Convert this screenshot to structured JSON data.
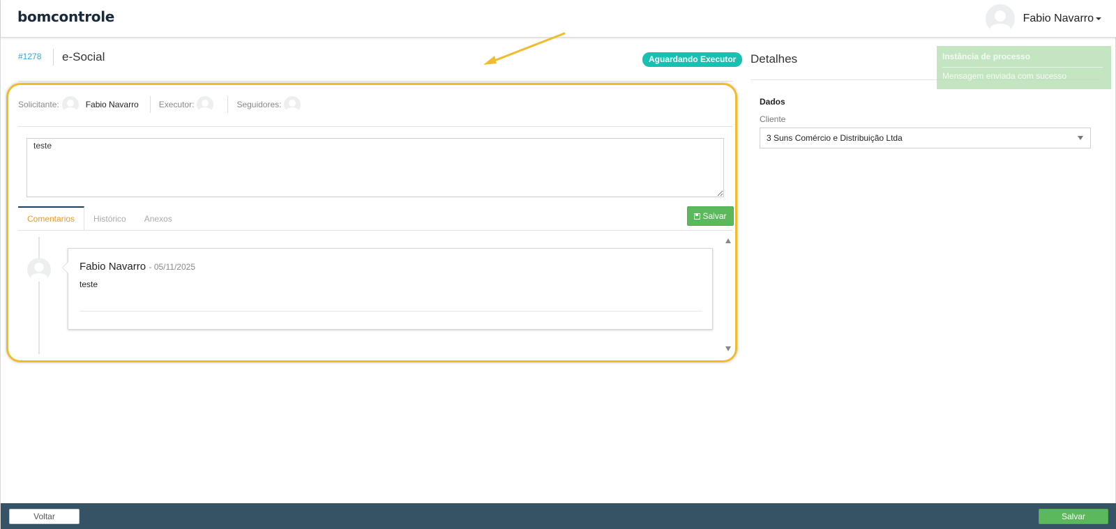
{
  "app": {
    "logo": "bomcontrole"
  },
  "header": {
    "user_name": "Fabio Navarro"
  },
  "task": {
    "id": "#1278",
    "title": "e-Social",
    "status": "Aguardando Executor",
    "status_color": "#17c0b0"
  },
  "people": {
    "requester_label": "Solicitante:",
    "requester_name": "Fabio Navarro",
    "executor_label": "Executor:",
    "followers_label": "Seguidores:"
  },
  "comment_input": {
    "value": "teste"
  },
  "tabs": [
    {
      "label": "Comentarios",
      "active": true
    },
    {
      "label": "Histórico",
      "active": false
    },
    {
      "label": "Anexos",
      "active": false
    }
  ],
  "actions": {
    "save_label": "Salvar"
  },
  "comments": [
    {
      "author": "Fabio Navarro",
      "date": "- 05/11/2025",
      "text": "teste"
    }
  ],
  "details": {
    "title": "Detalhes",
    "section": "Dados",
    "client_label": "Cliente",
    "client_value": "3 Suns Comércio e Distribuição Ltda"
  },
  "toast": {
    "title": "Instância de processo",
    "message": "Mensagem enviada com sucesso"
  },
  "footer": {
    "back_label": "Voltar",
    "save_label": "Salvar"
  },
  "colors": {
    "accent_tab": "#e29a2b",
    "highlight": "#f0bb2c",
    "save_green": "#5cb85c",
    "footer_bg": "#365265"
  }
}
